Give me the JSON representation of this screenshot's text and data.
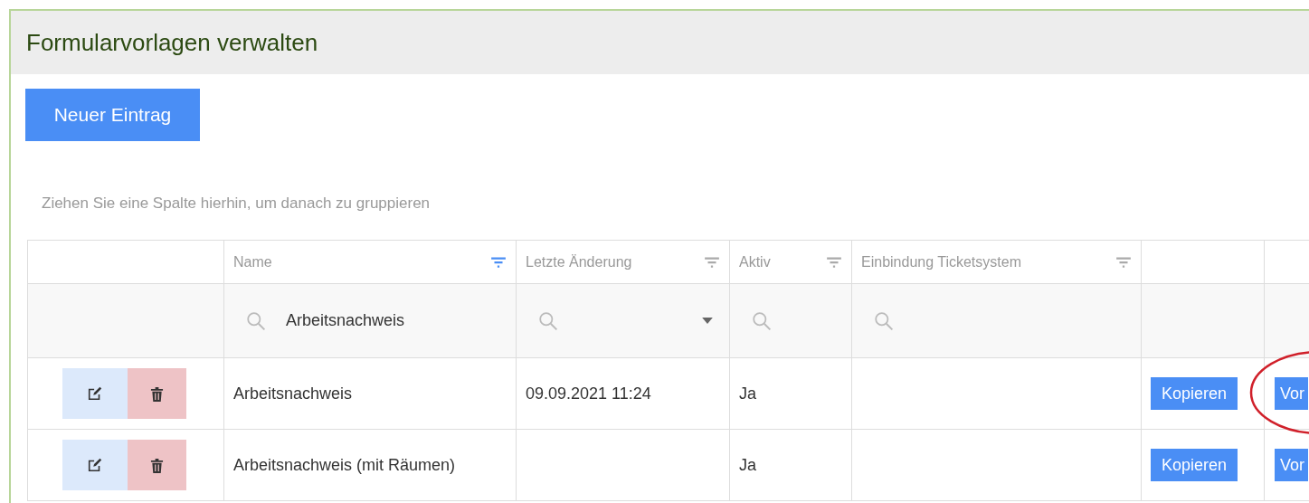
{
  "panel": {
    "title": "Formularvorlagen verwalten"
  },
  "new_button": "Neuer Eintrag",
  "group_hint": "Ziehen Sie eine Spalte hierhin, um danach zu gruppieren",
  "columns": [
    {
      "label": "Name",
      "filtered": true
    },
    {
      "label": "Letzte Änderung",
      "filtered": false
    },
    {
      "label": "Aktiv",
      "filtered": false
    },
    {
      "label": "Einbindung Ticketsystem",
      "filtered": false
    }
  ],
  "filters": [
    {
      "value": "Arbeitsnachweis",
      "dropdown": false
    },
    {
      "dropdown": true
    },
    {
      "dropdown": false
    },
    {
      "dropdown": false
    }
  ],
  "rows": [
    {
      "name": "Arbeitsnachweis",
      "last_change": "09.09.2021 11:24",
      "active": "Ja",
      "copy_button": "Kopieren",
      "preview_button": "Vor",
      "circled": true
    },
    {
      "name": "Arbeitsnachweis (mit Räumen)",
      "active": "Ja",
      "copy_button": "Kopieren",
      "preview_button": "Vor",
      "circled": false
    }
  ]
}
